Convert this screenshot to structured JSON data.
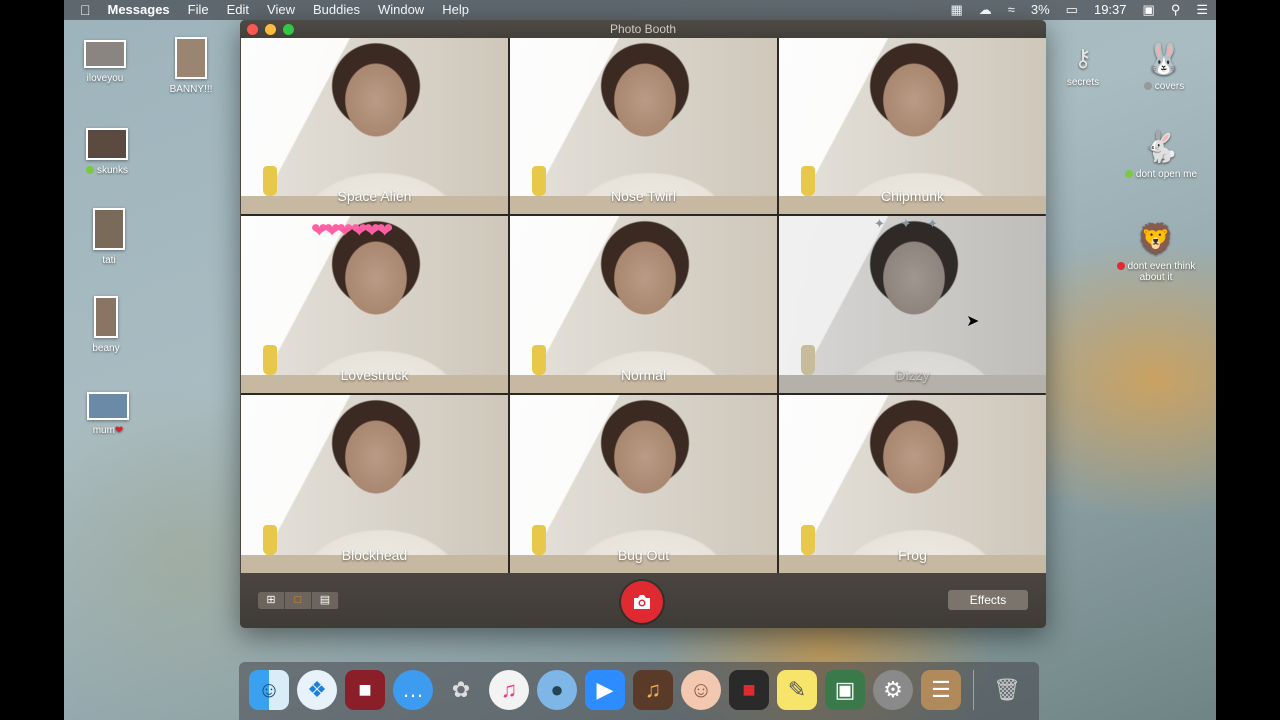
{
  "menubar": {
    "app_name": "Messages",
    "menus": [
      "File",
      "Edit",
      "View",
      "Buddies",
      "Window",
      "Help"
    ],
    "battery": "3%",
    "time": "19:37"
  },
  "desktop_icons": [
    {
      "label": "iloveyou"
    },
    {
      "label": "BANNY!!!"
    },
    {
      "label": "skunks"
    },
    {
      "label": "tati"
    },
    {
      "label": "beany"
    },
    {
      "label": "mum"
    },
    {
      "label": "secrets"
    },
    {
      "label": "covers"
    },
    {
      "label": "dont open me"
    },
    {
      "label": "dont even think about it"
    }
  ],
  "window": {
    "title": "Photo Booth",
    "effects": [
      "Space Alien",
      "Nose Twirl",
      "Chipmunk",
      "Lovestruck",
      "Normal",
      "Dizzy",
      "Blockhead",
      "Bug Out",
      "Frog"
    ],
    "effects_button": "Effects"
  },
  "dock": {
    "apps": [
      "finder-icon",
      "safari-icon",
      "photo-booth-icon",
      "messages-icon",
      "app-icon",
      "music-icon",
      "seal-icon",
      "zoom-icon",
      "garageband-icon",
      "face-icon",
      "photo-app-icon",
      "stickies-icon",
      "preview-icon",
      "system-preferences-icon",
      "contacts-icon",
      "trash-icon"
    ]
  },
  "colors": {
    "shutter": "#e02a31",
    "selected_view": "#f7931e"
  }
}
